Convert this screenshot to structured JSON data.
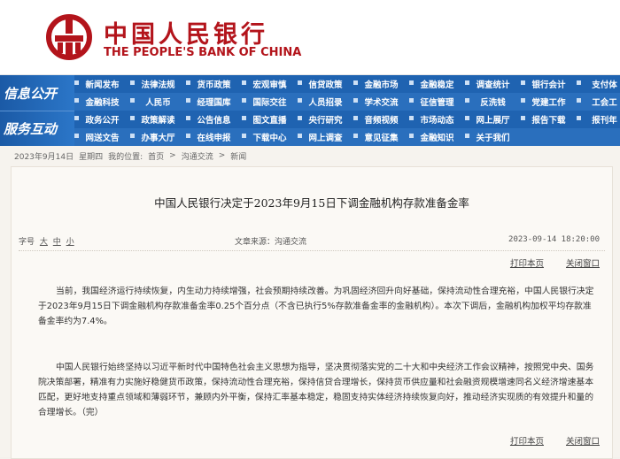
{
  "header": {
    "logo_cn": "中国人民银行",
    "logo_en": "THE PEOPLE'S BANK OF CHINA",
    "brand_color": "#b3141b"
  },
  "nav": {
    "section1": "信息公开",
    "section2": "服务互动",
    "rows": [
      [
        "新闻发布",
        "法律法规",
        "货币政策",
        "宏观审慎",
        "信贷政策",
        "金融市场",
        "金融稳定",
        "调查统计",
        "银行会计",
        "支付体"
      ],
      [
        "金融科技",
        "人民币",
        "经理国库",
        "国际交往",
        "人员招录",
        "学术交流",
        "征信管理",
        "反洗钱",
        "党建工作",
        "工会工"
      ],
      [
        "政务公开",
        "政策解读",
        "公告信息",
        "图文直播",
        "央行研究",
        "音频视频",
        "市场动态",
        "网上展厅",
        "报告下载",
        "报刊年"
      ],
      [
        "网送文告",
        "办事大厅",
        "在线申报",
        "下载中心",
        "网上调查",
        "意见征集",
        "金融知识",
        "关于我们",
        "",
        ""
      ]
    ]
  },
  "breadcrumb": {
    "date": "2023年9月14日",
    "weekday": "星期四",
    "location_label": "我的位置:",
    "path": [
      "首页",
      "沟通交流",
      "新闻"
    ]
  },
  "article": {
    "title": "中国人民银行决定于2023年9月15日下调金融机构存款准备金率",
    "font_label": "字号",
    "font_sizes": [
      "大",
      "中",
      "小"
    ],
    "source": "文章来源：沟通交流",
    "datetime": "2023-09-14 18:20:00",
    "print": "打印本页",
    "close": "关闭窗口",
    "p1": "当前，我国经济运行持续恢复，内生动力持续增强，社会预期持续改善。为巩固经济回升向好基础，保持流动性合理充裕，中国人民银行决定于2023年9月15日下调金融机构存款准备金率0.25个百分点（不含已执行5%存款准备金率的金融机构）。本次下调后，金融机构加权平均存款准备金率约为7.4%。",
    "p2": "中国人民银行始终坚持以习近平新时代中国特色社会主义思想为指导，坚决贯彻落实党的二十大和中央经济工作会议精神，按照党中央、国务院决策部署，精准有力实施好稳健货币政策，保持流动性合理充裕，保持信贷合理增长，保持货币供应量和社会融资规模增速同名义经济增速基本匹配，更好地支持重点领域和薄弱环节，兼顾内外平衡，保持汇率基本稳定，稳固支持实体经济持续恢复向好，推动经济实现质的有效提升和量的合理增长。（完）"
  }
}
